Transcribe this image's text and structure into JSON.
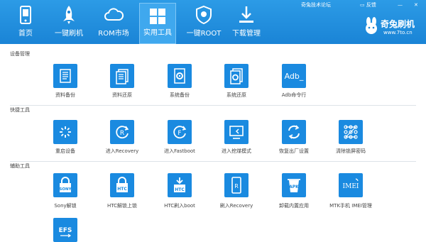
{
  "nav": [
    {
      "label": "首页",
      "icon": "phone-home-icon"
    },
    {
      "label": "一键刷机",
      "icon": "rocket-icon"
    },
    {
      "label": "ROM市场",
      "icon": "cloud-icon"
    },
    {
      "label": "实用工具",
      "icon": "grid-icon",
      "active": true
    },
    {
      "label": "一键ROOT",
      "icon": "shield-icon"
    },
    {
      "label": "下载管理",
      "icon": "download-icon"
    }
  ],
  "window": {
    "forum": "奇兔技术论坛",
    "feedback": "反馈",
    "minimize": "—",
    "close": "✕"
  },
  "brand": {
    "name": "奇兔刷机",
    "url": "www.7to.cn"
  },
  "sections": [
    {
      "title": "设备管理",
      "items": [
        {
          "label": "资料备份",
          "icon": "document-icon"
        },
        {
          "label": "资料还原",
          "icon": "document-restore-icon"
        },
        {
          "label": "系统备份",
          "icon": "system-backup-icon"
        },
        {
          "label": "系统还原",
          "icon": "system-restore-icon"
        },
        {
          "label": "Adb命令行",
          "icon": "adb-icon",
          "icon_text": "Adb_"
        }
      ]
    },
    {
      "title": "快捷工具",
      "items": [
        {
          "label": "重启设备",
          "icon": "reboot-icon"
        },
        {
          "label": "进入Recovery",
          "icon": "recovery-icon"
        },
        {
          "label": "进入Fastboot",
          "icon": "fastboot-icon"
        },
        {
          "label": "进入挖煤模式",
          "icon": "download-mode-icon"
        },
        {
          "label": "恢复出厂设置",
          "icon": "factory-reset-icon"
        },
        {
          "label": "清除锁屏密码",
          "icon": "pattern-lock-icon"
        }
      ]
    },
    {
      "title": "辅助工具",
      "items": [
        {
          "label": "Sony解锁",
          "icon": "sony-lock-icon",
          "icon_text": "SONY"
        },
        {
          "label": "HTC解锁上锁",
          "icon": "htc-lock-icon",
          "icon_text": "HTC"
        },
        {
          "label": "HTC刷入boot",
          "icon": "htc-boot-icon",
          "icon_text": "HTC"
        },
        {
          "label": "刷入Recovery",
          "icon": "flash-recovery-icon"
        },
        {
          "label": "卸载内置应用",
          "icon": "apk-uninstall-icon",
          "icon_text": "APK"
        },
        {
          "label": "MTK手机 IMEI管理",
          "icon": "imei-icon",
          "icon_text": "IMEI"
        },
        {
          "label": "",
          "icon": "efs-icon",
          "icon_text": "EFS"
        }
      ]
    }
  ]
}
